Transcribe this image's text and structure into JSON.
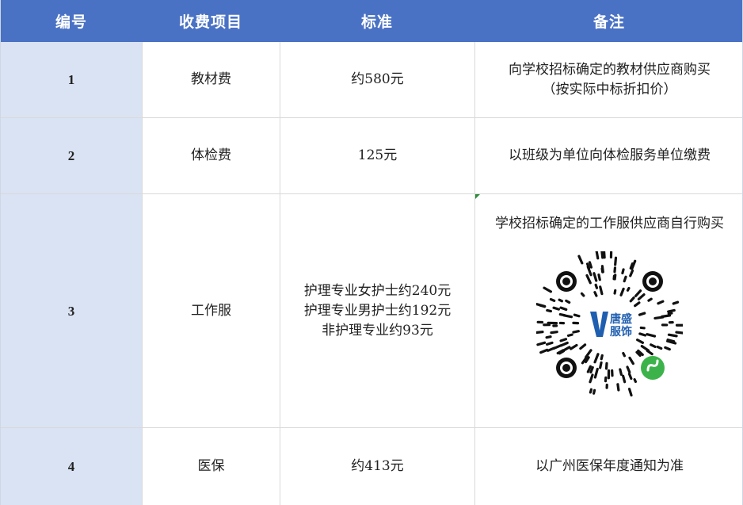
{
  "header": {
    "col1": "编号",
    "col2": "收费项目",
    "col3": "标准",
    "col4": "备注"
  },
  "rows": [
    {
      "num": "1",
      "item": "教材费",
      "standard": [
        "约580元"
      ],
      "notes": [
        "向学校招标确定的教材供应商购买",
        "（按实际中标折扣价）"
      ]
    },
    {
      "num": "2",
      "item": "体检费",
      "standard": [
        "125元"
      ],
      "notes": [
        "以班级为单位向体检服务单位缴费"
      ]
    },
    {
      "num": "3",
      "item": "工作服",
      "standard": [
        "护理专业女护士约240元",
        "护理专业男护士约192元",
        "非护理专业约93元"
      ],
      "notes": [
        "学校招标确定的工作服供应商自行购买"
      ],
      "qr": {
        "logo_line1": "唐盛",
        "logo_line2": "服饰",
        "icon": "mini-program-qr-code"
      }
    },
    {
      "num": "4",
      "item": "医保",
      "standard": [
        "约413元"
      ],
      "notes": [
        "以广州医保年度通知为准"
      ]
    }
  ],
  "colors": {
    "header_bg": "#4a72c4",
    "number_col_bg": "#dae3f3",
    "qr_logo_blue": "#1f5fb0",
    "mini_program_green": "#3cb34a"
  }
}
